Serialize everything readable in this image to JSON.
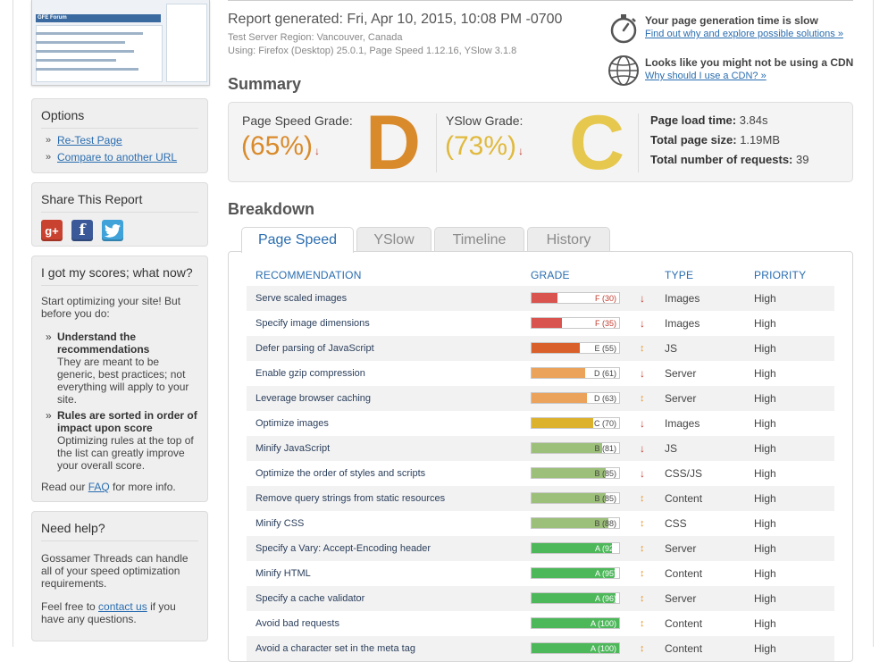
{
  "thumbnail": {
    "title": "GFE Forum"
  },
  "options": {
    "title": "Options",
    "links": [
      "Re-Test Page",
      "Compare to another URL"
    ]
  },
  "share": {
    "title": "Share This Report",
    "icons": [
      {
        "name": "google-plus-icon",
        "glyph": "g+",
        "color": "#c9412f"
      },
      {
        "name": "facebook-icon",
        "glyph": "f",
        "color": "#3b5998"
      },
      {
        "name": "twitter-icon",
        "glyph": "t",
        "color": "#3fa3d9"
      }
    ]
  },
  "scores_help": {
    "title": "I got my scores; what now?",
    "intro": "Start optimizing your site! But before you do:",
    "items": [
      {
        "bold": "Understand the recommendations",
        "text": "They are meant to be generic, best practices; not everything will apply to your site."
      },
      {
        "bold": "Rules are sorted in order of impact upon score",
        "text": "Optimizing rules at the top of the list can greatly improve your overall score."
      }
    ],
    "faq_prefix": "Read our ",
    "faq_link": "FAQ",
    "faq_suffix": " for more info."
  },
  "need_help": {
    "title": "Need help?",
    "text": "Gossamer Threads can handle all of your speed optimization requirements.",
    "contact_prefix": "Feel free to ",
    "contact_link": "contact us",
    "contact_suffix": " if you have any questions."
  },
  "report": {
    "generated": "Report generated: Fri, Apr 10, 2015, 10:08 PM -0700",
    "region": "Test Server Region: Vancouver, Canada",
    "using": "Using: Firefox (Desktop) 25.0.1, Page Speed 1.12.16, YSlow 3.1.8"
  },
  "notices": [
    {
      "title": "Your page generation time is slow",
      "link": "Find out why and explore possible solutions »",
      "icon": "stopwatch-icon"
    },
    {
      "title": "Looks like you might not be using a CDN",
      "link": "Why should I use a CDN? »",
      "icon": "globe-icon"
    }
  ],
  "summary": {
    "heading": "Summary",
    "pagespeed": {
      "label": "Page Speed Grade:",
      "pct": "(65%)",
      "letter": "D",
      "color": "#d98a2b"
    },
    "yslow": {
      "label": "YSlow Grade:",
      "pct": "(73%)",
      "letter": "C",
      "color": "#e0b93d"
    },
    "metrics": [
      {
        "label": "Page load time:",
        "value": "3.84s"
      },
      {
        "label": "Total page size:",
        "value": "1.19MB"
      },
      {
        "label": "Total number of requests:",
        "value": "39"
      }
    ]
  },
  "breakdown": {
    "heading": "Breakdown",
    "tabs": [
      "Page Speed",
      "YSlow",
      "Timeline",
      "History"
    ],
    "active_tab": 0,
    "columns": [
      "RECOMMENDATION",
      "GRADE",
      "TYPE",
      "PRIORITY"
    ],
    "rows": [
      {
        "rec": "Serve scaled images",
        "grade": "F (30)",
        "score": 30,
        "color": "#d9534f",
        "trend": "down",
        "type": "Images",
        "priority": "High"
      },
      {
        "rec": "Specify image dimensions",
        "grade": "F (35)",
        "score": 35,
        "color": "#d9534f",
        "trend": "down",
        "type": "Images",
        "priority": "High"
      },
      {
        "rec": "Defer parsing of JavaScript",
        "grade": "E (55)",
        "score": 55,
        "color": "#d9602a",
        "trend": "flat",
        "type": "JS",
        "priority": "High"
      },
      {
        "rec": "Enable gzip compression",
        "grade": "D (61)",
        "score": 61,
        "color": "#eba25a",
        "trend": "down",
        "type": "Server",
        "priority": "High"
      },
      {
        "rec": "Leverage browser caching",
        "grade": "D (63)",
        "score": 63,
        "color": "#eba25a",
        "trend": "flat",
        "type": "Server",
        "priority": "High"
      },
      {
        "rec": "Optimize images",
        "grade": "C (70)",
        "score": 70,
        "color": "#dcb12b",
        "trend": "down",
        "type": "Images",
        "priority": "High"
      },
      {
        "rec": "Minify JavaScript",
        "grade": "B (81)",
        "score": 81,
        "color": "#9cbf7a",
        "trend": "down",
        "type": "JS",
        "priority": "High"
      },
      {
        "rec": "Optimize the order of styles and scripts",
        "grade": "B (85)",
        "score": 85,
        "color": "#9cbf7a",
        "trend": "down",
        "type": "CSS/JS",
        "priority": "High"
      },
      {
        "rec": "Remove query strings from static resources",
        "grade": "B (85)",
        "score": 85,
        "color": "#9cbf7a",
        "trend": "flat",
        "type": "Content",
        "priority": "High"
      },
      {
        "rec": "Minify CSS",
        "grade": "B (88)",
        "score": 88,
        "color": "#9cbf7a",
        "trend": "flat",
        "type": "CSS",
        "priority": "High"
      },
      {
        "rec": "Specify a Vary: Accept-Encoding header",
        "grade": "A (92)",
        "score": 92,
        "color": "#4db85a",
        "trend": "flat",
        "type": "Server",
        "priority": "High"
      },
      {
        "rec": "Minify HTML",
        "grade": "A (95)",
        "score": 95,
        "color": "#4db85a",
        "trend": "flat",
        "type": "Content",
        "priority": "High"
      },
      {
        "rec": "Specify a cache validator",
        "grade": "A (96)",
        "score": 96,
        "color": "#4db85a",
        "trend": "flat",
        "type": "Server",
        "priority": "High"
      },
      {
        "rec": "Avoid bad requests",
        "grade": "A (100)",
        "score": 100,
        "color": "#4db85a",
        "trend": "flat",
        "type": "Content",
        "priority": "High"
      },
      {
        "rec": "Avoid a character set in the meta tag",
        "grade": "A (100)",
        "score": 100,
        "color": "#4db85a",
        "trend": "flat",
        "type": "Content",
        "priority": "High"
      }
    ]
  }
}
